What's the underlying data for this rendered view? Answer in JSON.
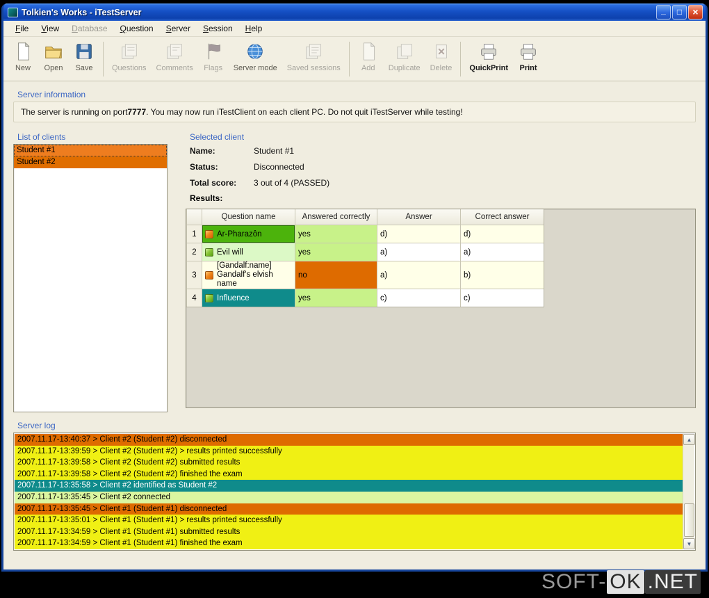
{
  "window": {
    "title": "Tolkien's Works - iTestServer",
    "buttons": {
      "minimize": "_",
      "maximize": "□",
      "close": "×"
    }
  },
  "menu": {
    "items": [
      {
        "label": "File",
        "disabled": false
      },
      {
        "label": "View",
        "disabled": false
      },
      {
        "label": "Database",
        "disabled": true
      },
      {
        "label": "Question",
        "disabled": false
      },
      {
        "label": "Server",
        "disabled": false
      },
      {
        "label": "Session",
        "disabled": false
      },
      {
        "label": "Help",
        "disabled": false
      }
    ]
  },
  "toolbar": {
    "items": [
      {
        "label": "New",
        "icon": "new-document-icon",
        "disabled": false
      },
      {
        "label": "Open",
        "icon": "open-folder-icon",
        "disabled": false
      },
      {
        "label": "Save",
        "icon": "save-icon",
        "disabled": false
      },
      {
        "label": "Questions",
        "icon": "questions-icon",
        "disabled": true
      },
      {
        "label": "Comments",
        "icon": "comments-icon",
        "disabled": true
      },
      {
        "label": "Flags",
        "icon": "flags-icon",
        "disabled": true
      },
      {
        "label": "Server mode",
        "icon": "server-mode-icon",
        "disabled": false
      },
      {
        "label": "Saved sessions",
        "icon": "saved-sessions-icon",
        "disabled": true
      },
      {
        "label": "Add",
        "icon": "add-icon",
        "disabled": true
      },
      {
        "label": "Duplicate",
        "icon": "duplicate-icon",
        "disabled": true
      },
      {
        "label": "Delete",
        "icon": "delete-icon",
        "disabled": true
      },
      {
        "label": "QuickPrint",
        "icon": "quickprint-icon",
        "disabled": false
      },
      {
        "label": "Print",
        "icon": "print-icon",
        "disabled": false
      }
    ]
  },
  "server_info": {
    "heading": "Server information",
    "text_pre": "The server is running on port ",
    "port": "7777",
    "text_post": ". You may now run iTestClient on each client PC. Do not quit iTestServer while testing!"
  },
  "clients": {
    "heading": "List of clients",
    "items": [
      {
        "label": "Student #1",
        "bg": "#EE7D1F",
        "selected": true
      },
      {
        "label": "Student #2",
        "bg": "#E06E00",
        "selected": false
      }
    ]
  },
  "selected_client": {
    "heading": "Selected client",
    "fields": [
      {
        "label": "Name:",
        "value": "Student #1"
      },
      {
        "label": "Status:",
        "value": "Disconnected"
      },
      {
        "label": "Total score:",
        "value": "3 out of 4 (PASSED)"
      }
    ],
    "results_label": "Results:",
    "table": {
      "headers": [
        "",
        "Question name",
        "Answered correctly",
        "Answer",
        "Correct answer"
      ],
      "rows": [
        {
          "num": "1",
          "icon": "orange-tag-icon",
          "question": "Ar-Pharazôn",
          "q_bg": "#4CB30C",
          "q_fg": "#000000",
          "answered": "yes",
          "ans_bg": "#C8F289",
          "ans_fg": "#000000",
          "answer": "d)",
          "correct": "d)",
          "cell_bg": "#FFFFE8"
        },
        {
          "num": "2",
          "icon": "green-tag-icon",
          "question": "Evil will",
          "q_bg": "#DCF9C6",
          "q_fg": "#000000",
          "answered": "yes",
          "ans_bg": "#C8F289",
          "ans_fg": "#000000",
          "answer": "a)",
          "correct": "a)",
          "cell_bg": "#FFFFFF"
        },
        {
          "num": "3",
          "icon": "orange-tag-icon",
          "question": "[Gandalf:name]",
          "question_line2": "Gandalf's elvish name",
          "q_bg": "#FFFFE8",
          "q_fg": "#000000",
          "answered": "no",
          "ans_bg": "#DE6B00",
          "ans_fg": "#000000",
          "answer": "a)",
          "correct": "b)",
          "cell_bg": "#FFFFE8"
        },
        {
          "num": "4",
          "icon": "green-tag-icon",
          "question": "Influence",
          "q_bg": "#0F8B8B",
          "q_fg": "#FFFFFF",
          "answered": "yes",
          "ans_bg": "#C8F289",
          "ans_fg": "#000000",
          "answer": "c)",
          "correct": "c)",
          "cell_bg": "#FFFFFF"
        }
      ]
    }
  },
  "server_log": {
    "heading": "Server log",
    "entries": [
      {
        "text": "2007.11.17-13:40:37 > Client #2 (Student #2) disconnected",
        "bg": "#DE6B00",
        "fg": "#000000"
      },
      {
        "text": "2007.11.17-13:39:59 > Client #2 (Student #2) > results printed successfully",
        "bg": "#F0F014",
        "fg": "#000000"
      },
      {
        "text": "2007.11.17-13:39:58 > Client #2 (Student #2) submitted results",
        "bg": "#F0F014",
        "fg": "#000000"
      },
      {
        "text": "2007.11.17-13:39:58 > Client #2 (Student #2) finished the exam",
        "bg": "#F0F014",
        "fg": "#000000"
      },
      {
        "text": "2007.11.17-13:35:58 > Client #2 identified as Student #2",
        "bg": "#0F8B8B",
        "fg": "#FFFFFF"
      },
      {
        "text": "2007.11.17-13:35:45 > Client #2 connected",
        "bg": "#DBF6A0",
        "fg": "#000000"
      },
      {
        "text": "2007.11.17-13:35:45 > Client #1 (Student #1) disconnected",
        "bg": "#DE6B00",
        "fg": "#000000"
      },
      {
        "text": "2007.11.17-13:35:01 > Client #1 (Student #1) > results printed successfully",
        "bg": "#F0F014",
        "fg": "#000000"
      },
      {
        "text": "2007.11.17-13:34:59 > Client #1 (Student #1) submitted results",
        "bg": "#F0F014",
        "fg": "#000000"
      },
      {
        "text": "2007.11.17-13:34:59 > Client #1 (Student #1) finished the exam",
        "bg": "#F0F014",
        "fg": "#000000"
      }
    ]
  },
  "scrollbar": {
    "up": "▲",
    "down": "▼"
  },
  "watermark": {
    "part1": "SOFT-",
    "part2": "OK",
    "part3": ".NET"
  },
  "colors": {
    "heading_blue": "#3B66C4",
    "titlebar_blue": "#1550C4",
    "close_red": "#C02D10",
    "status_orange": "#DE6B00",
    "status_yellow": "#F0F014",
    "status_teal": "#0F8B8B",
    "status_pale_green": "#DBF6A0",
    "yes_green": "#C8F289",
    "question_green": "#4CB30C",
    "window_bg": "#F0EDE0"
  }
}
